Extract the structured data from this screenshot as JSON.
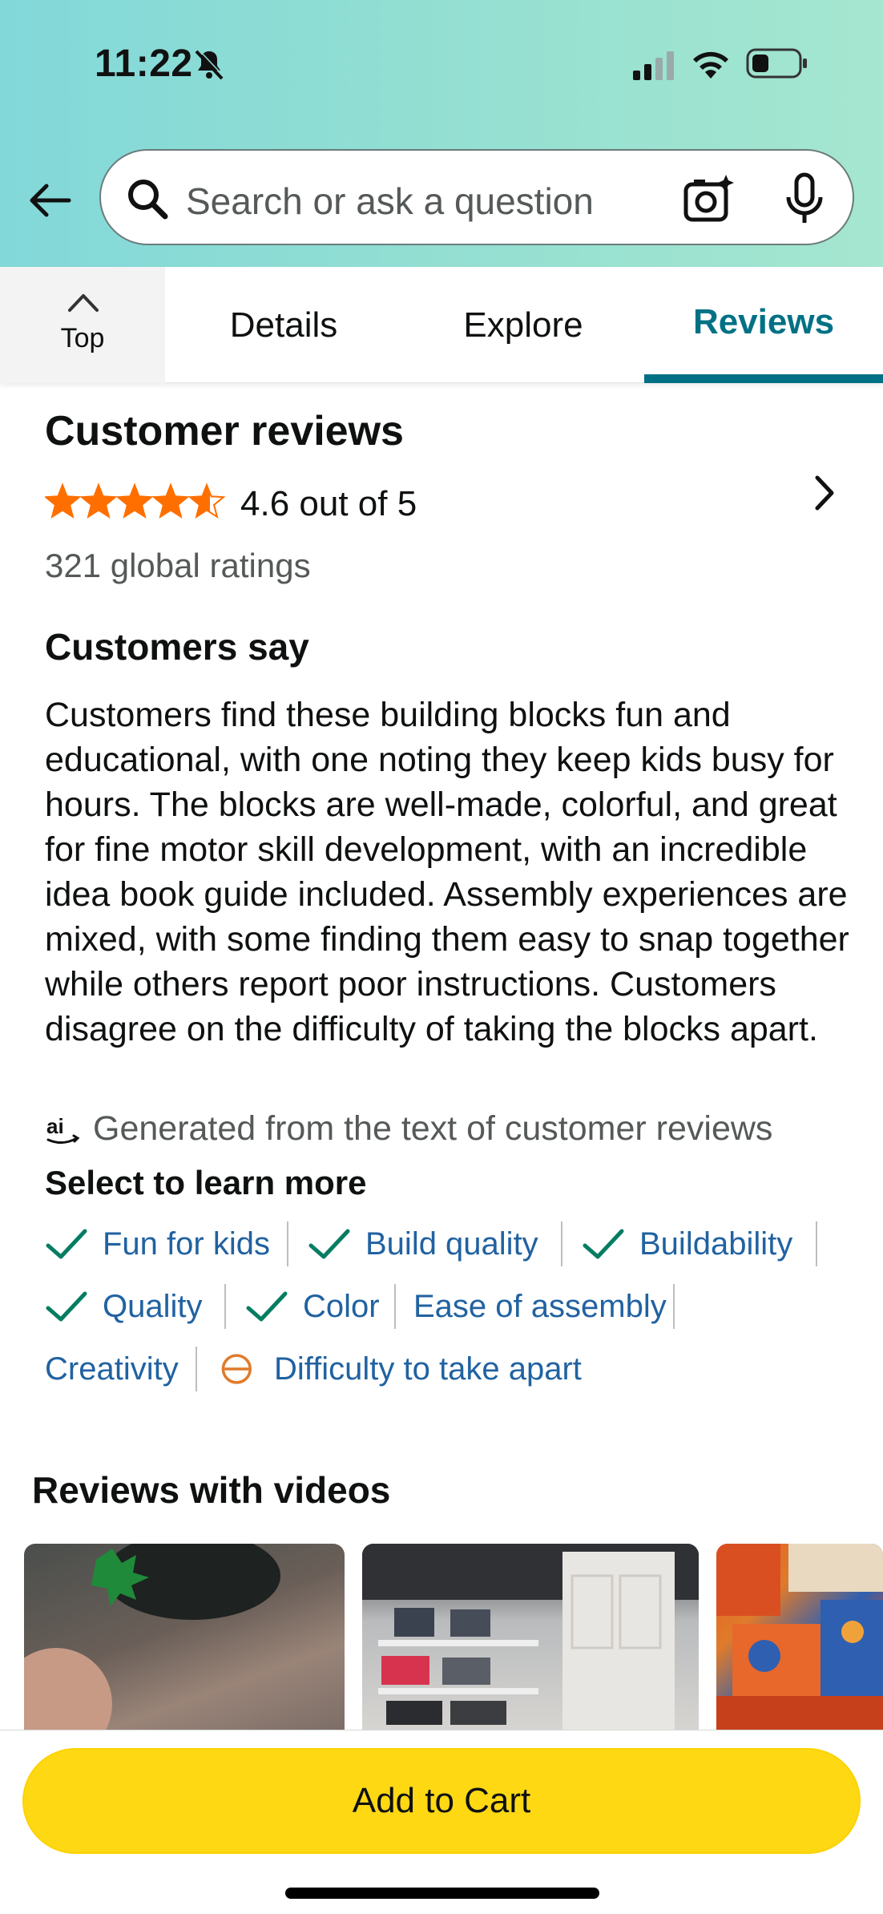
{
  "status_bar": {
    "time": "11:22"
  },
  "search": {
    "placeholder": "Search or ask a question"
  },
  "tabs": {
    "top": "Top",
    "details": "Details",
    "explore": "Explore",
    "reviews": "Reviews"
  },
  "reviews": {
    "title": "Customer reviews",
    "rating": 4.6,
    "rating_text": "4.6 out of 5",
    "global_ratings": "321 global ratings",
    "customers_say_title": "Customers say",
    "summary": "Customers find these building blocks fun and educational, with one noting they keep kids busy for hours. The blocks are well-made, colorful, and great for fine motor skill development, with an incredible idea book guide included. Assembly experiences are mixed, with some finding them easy to snap together while others report poor instructions. Customers disagree on the difficulty of taking the blocks apart.",
    "ai_note": "Generated from the text of customer reviews",
    "select_title": "Select to learn more",
    "chips": [
      {
        "label": "Fun for kids",
        "sentiment": "positive"
      },
      {
        "label": "Build quality",
        "sentiment": "positive"
      },
      {
        "label": "Buildability",
        "sentiment": "positive"
      },
      {
        "label": "Quality",
        "sentiment": "positive"
      },
      {
        "label": "Color",
        "sentiment": "positive"
      },
      {
        "label": "Ease of assembly",
        "sentiment": "none"
      },
      {
        "label": "Creativity",
        "sentiment": "none"
      },
      {
        "label": "Difficulty to take apart",
        "sentiment": "mixed"
      }
    ],
    "videos_title": "Reviews with videos"
  },
  "cart": {
    "label": "Add to Cart"
  },
  "colors": {
    "accent": "#007185",
    "link": "#2162a1",
    "star": "#ff6f00",
    "cart": "#ffd814",
    "check": "#067d62",
    "mixed": "#e07b2b"
  }
}
